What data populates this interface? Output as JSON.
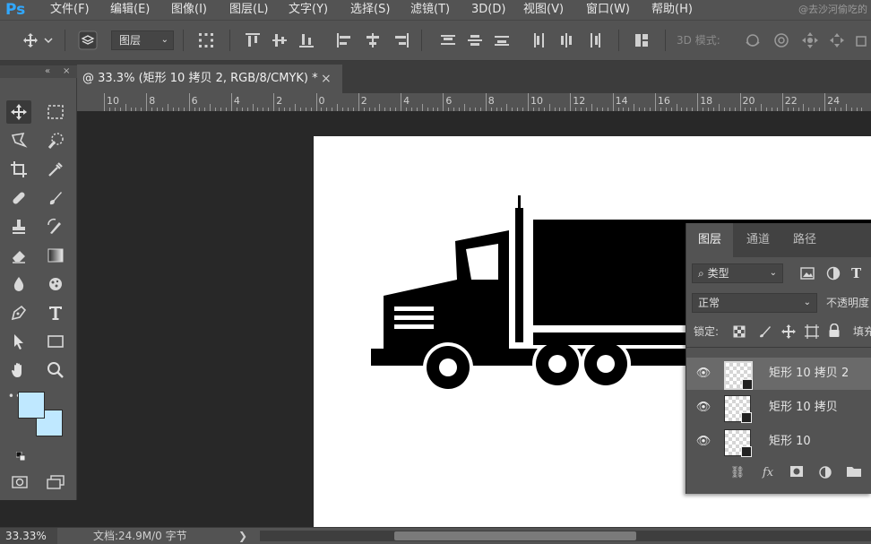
{
  "app": {
    "logo": "Ps",
    "watermark": "@去沙河偷吃的"
  },
  "menu": [
    "文件(F)",
    "编辑(E)",
    "图像(I)",
    "图层(L)",
    "文字(Y)",
    "选择(S)",
    "滤镜(T)",
    "3D(D)",
    "视图(V)",
    "窗口(W)",
    "帮助(H)"
  ],
  "options": {
    "auto_select_target": "图层",
    "mode_3d": "3D 模式:"
  },
  "document": {
    "tab_title": "@ 33.3% (矩形 10 拷贝 2, RGB/8/CMYK) *",
    "close": "×"
  },
  "ruler": {
    "labels": [
      "10",
      "8",
      "6",
      "4",
      "2",
      "0",
      "2",
      "4",
      "6",
      "8",
      "10",
      "12",
      "14",
      "16",
      "18",
      "20",
      "22",
      "24"
    ]
  },
  "toolbox": {
    "collapse": "«",
    "close": "×",
    "more": "•••"
  },
  "colors": {
    "foreground": "#bfe8ff",
    "background": "#bfe8ff",
    "accent": "#31a8ff"
  },
  "layers_panel": {
    "tabs": [
      "图层",
      "通道",
      "路径"
    ],
    "filter_kind": "类型",
    "blend_mode": "正常",
    "opacity_label": "不透明度",
    "lock_label": "锁定:",
    "fill_label": "填充",
    "layers": [
      {
        "name": "矩形 10 拷贝 2",
        "selected": true
      },
      {
        "name": "矩形 10 拷贝",
        "selected": false
      },
      {
        "name": "矩形 10",
        "selected": false
      }
    ],
    "footer_fx": "fx"
  },
  "status": {
    "zoom": "33.33%",
    "doc_size": "文档:24.9M/0 字节",
    "arrow": "❯"
  }
}
